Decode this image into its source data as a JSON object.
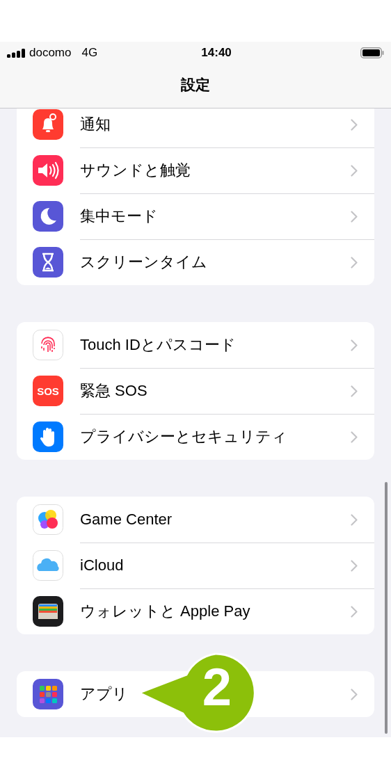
{
  "status_bar": {
    "carrier": "docomo",
    "network": "4G",
    "time": "14:40"
  },
  "nav": {
    "title": "設定"
  },
  "groups": [
    {
      "items": [
        {
          "label": "通知"
        },
        {
          "label": "サウンドと触覚"
        },
        {
          "label": "集中モード"
        },
        {
          "label": "スクリーンタイム"
        }
      ]
    },
    {
      "items": [
        {
          "label": "Touch IDとパスコード"
        },
        {
          "label": "緊急 SOS",
          "icon_text": "SOS"
        },
        {
          "label": "プライバシーとセキュリティ"
        }
      ]
    },
    {
      "items": [
        {
          "label": "Game Center"
        },
        {
          "label": "iCloud"
        },
        {
          "label": "ウォレットと Apple Pay"
        }
      ]
    },
    {
      "items": [
        {
          "label": "アプリ"
        }
      ]
    }
  ],
  "callout": {
    "number": "2"
  }
}
